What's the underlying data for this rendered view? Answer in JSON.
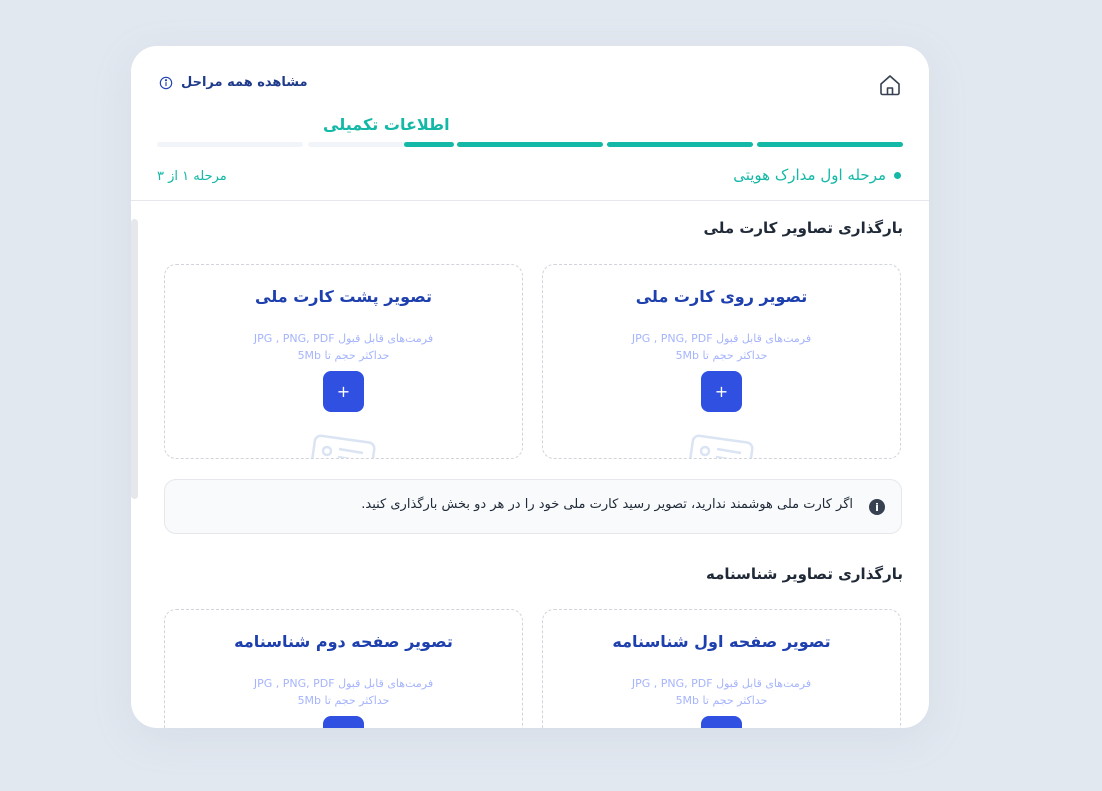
{
  "header": {
    "view_all_label": "مشاهده همه مراحل",
    "step_title": "اطلاعات تکمیلی",
    "stage_label": "مرحله اول مدارک هویتی",
    "stage_count": "مرحله ۱ از ۳"
  },
  "progress": {
    "filled_segments": 3,
    "total_segments": 5,
    "partial_segment_fraction": 0.33
  },
  "sections": [
    {
      "title": "بارگذاری تصاویر کارت ملی",
      "boxes": [
        {
          "title": "تصویر روی کارت ملی",
          "formats": "فرمت‌های قابل قبول JPG , PNG, PDF",
          "max_size": "حداکثر حجم تا 5Mb",
          "button": "+"
        },
        {
          "title": "تصویر پشت کارت ملی",
          "formats": "فرمت‌های قابل قبول JPG , PNG, PDF",
          "max_size": "حداکثر حجم تا 5Mb",
          "button": "+"
        }
      ]
    },
    {
      "title": "بارگذاری تصاویر شناسنامه",
      "boxes": [
        {
          "title": "تصویر صفحه اول شناسنامه",
          "formats": "فرمت‌های قابل قبول JPG , PNG, PDF",
          "max_size": "حداکثر حجم تا 5Mb",
          "button": "+"
        },
        {
          "title": "تصویر صفحه دوم شناسنامه",
          "formats": "فرمت‌های قابل قبول JPG , PNG, PDF",
          "max_size": "حداکثر حجم تا 5Mb",
          "button": "+"
        }
      ]
    }
  ],
  "notice": {
    "text": "اگر کارت ملی هوشمند ندارید، تصویر رسید کارت ملی خود را در هر دو بخش بارگذاری کنید.",
    "icon": "info-icon"
  },
  "colors": {
    "accent": "#14b8a6",
    "primary": "#2f50e0",
    "title_blue": "#1e40af"
  }
}
